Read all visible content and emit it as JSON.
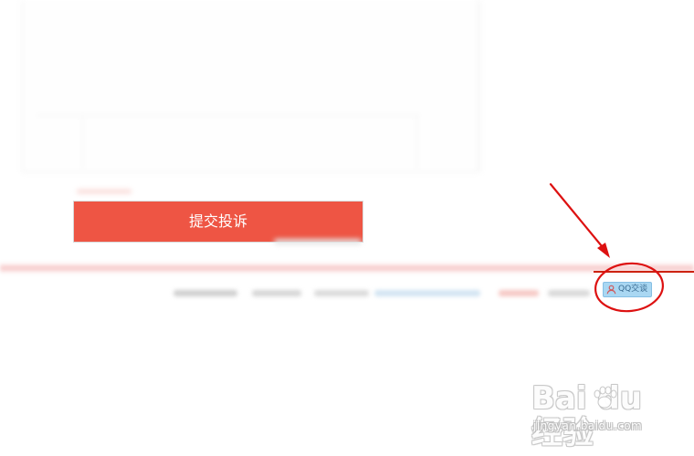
{
  "form": {
    "submit_label": "提交投诉"
  },
  "footer": {
    "qq_chat_label": "QQ交谈",
    "qq_icon": "user-icon"
  },
  "annotation": {
    "icons": [
      "arrow-icon",
      "circle-highlight-icon"
    ],
    "color": "#dd1111"
  },
  "watermark": {
    "brand_text": "Bai du 经验",
    "url_text": "jingyan.baidu.com",
    "icon": "paw-icon"
  },
  "colors": {
    "accent": "#ee5544",
    "qq_button": "#a9d7f2",
    "annotation_red": "#dd1111"
  }
}
